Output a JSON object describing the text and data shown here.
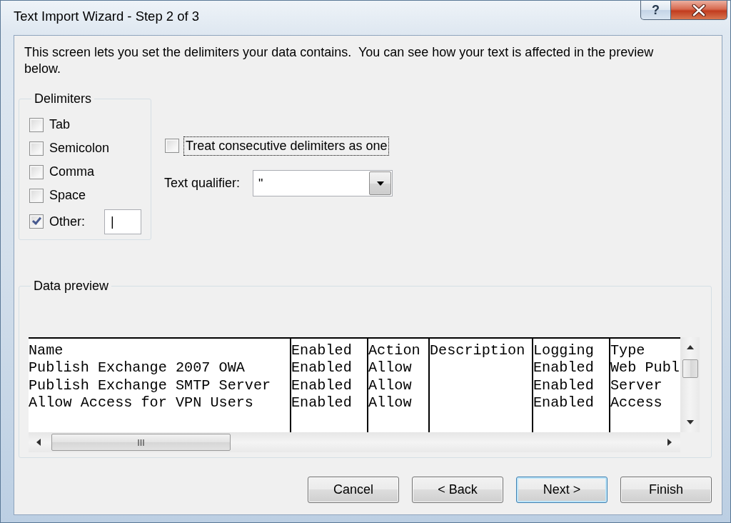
{
  "window": {
    "title": "Text Import Wizard - Step 2 of 3",
    "help_button": "?"
  },
  "instructions": "This screen lets you set the delimiters your data contains.  You can see how your text is affected in the preview below.",
  "delimiters": {
    "label": "Delimiters",
    "options": [
      {
        "kind": "checkbox",
        "label": "Tab",
        "checked": false
      },
      {
        "kind": "checkbox",
        "label": "Semicolon",
        "checked": false
      },
      {
        "kind": "checkbox",
        "label": "Comma",
        "checked": false
      },
      {
        "kind": "checkbox",
        "label": "Space",
        "checked": false
      },
      {
        "kind": "checkbox_with_field",
        "label": "Other:",
        "checked": true,
        "value": "|"
      }
    ]
  },
  "treat_consecutive": {
    "label": "Treat consecutive delimiters as one",
    "checked": false,
    "focused": true
  },
  "text_qualifier": {
    "label": "Text qualifier:",
    "value": "\""
  },
  "data_preview": {
    "label": "Data preview",
    "columns": [
      {
        "cells": [
          "Name",
          "Publish Exchange 2007 OWA",
          "Publish Exchange SMTP Server",
          "Allow Access for VPN Users"
        ]
      },
      {
        "cells": [
          "Enabled",
          "Enabled",
          "Enabled",
          "Enabled"
        ]
      },
      {
        "cells": [
          "Action",
          "Allow",
          "Allow",
          "Allow"
        ]
      },
      {
        "cells": [
          "Description"
        ]
      },
      {
        "cells": [
          "Logging",
          "Enabled",
          "Enabled",
          "Enabled"
        ]
      },
      {
        "cells": [
          "Type",
          "Web Publ",
          "Server",
          "Access"
        ]
      }
    ]
  },
  "buttons": [
    {
      "label": "Cancel",
      "default": false
    },
    {
      "label": "< Back",
      "default": false
    },
    {
      "label": "Next >",
      "default": true
    },
    {
      "label": "Finish",
      "default": false
    }
  ]
}
